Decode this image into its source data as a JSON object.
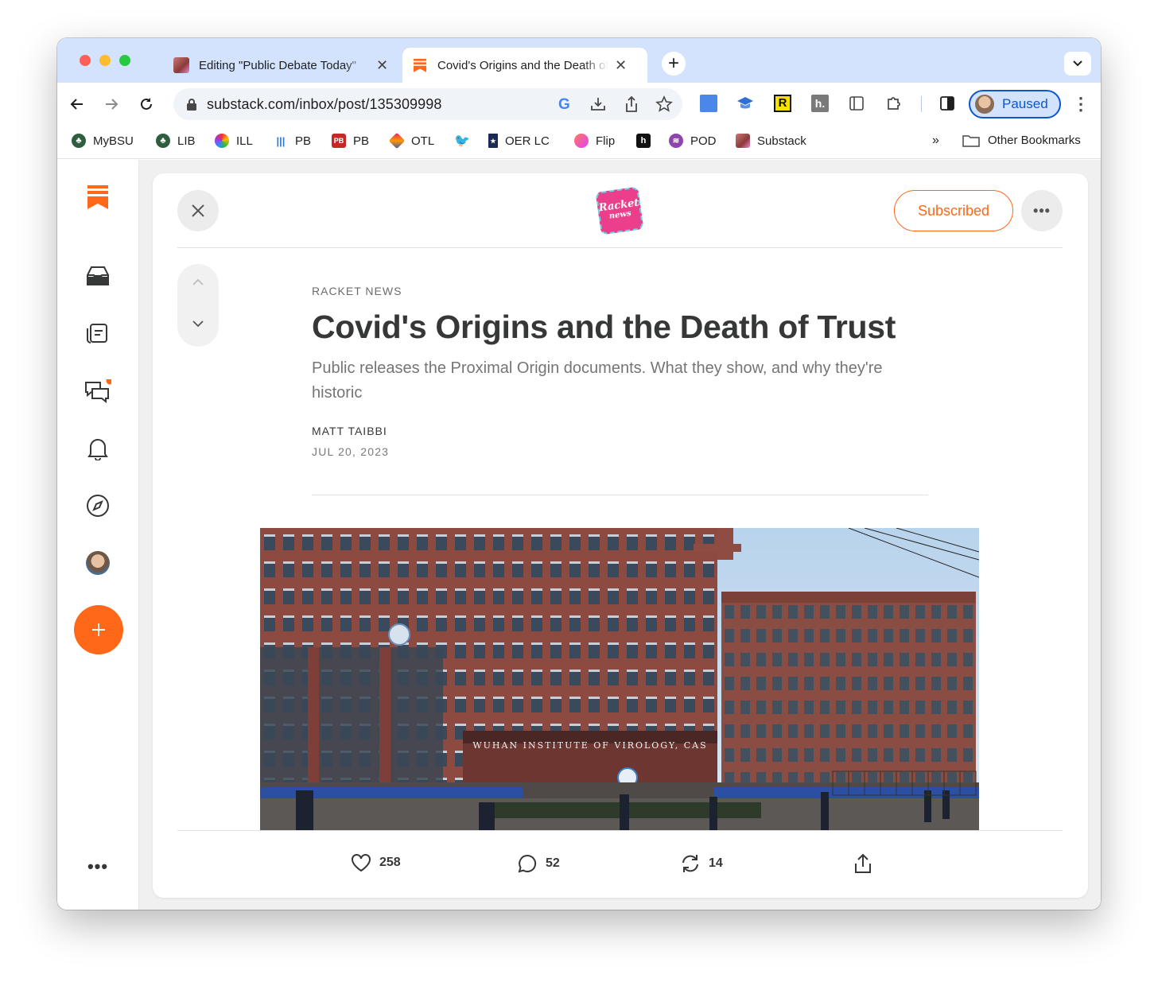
{
  "tabs": [
    {
      "title": "Editing \"Public Debate Today\"",
      "active": false
    },
    {
      "title": "Covid's Origins and the Death of Trust",
      "active": true
    }
  ],
  "address": {
    "url": "substack.com/inbox/post/135309998"
  },
  "profile": {
    "label": "Paused"
  },
  "bookmarks": [
    {
      "label": "MyBSU",
      "icon": "tree-icon"
    },
    {
      "label": "LIB",
      "icon": "tree-icon"
    },
    {
      "label": "ILL",
      "icon": "rainbow-icon"
    },
    {
      "label": "PB",
      "icon": "bars-icon"
    },
    {
      "label": "PB",
      "icon": "pb-icon"
    },
    {
      "label": "OTL",
      "icon": "diamond-icon"
    },
    {
      "label": "",
      "icon": "twitter-icon"
    },
    {
      "label": "OER LC",
      "icon": "bookmark-icon"
    },
    {
      "label": "Flip",
      "icon": "flip-icon"
    },
    {
      "label": "",
      "icon": "h-icon"
    },
    {
      "label": "POD",
      "icon": "spotify-icon"
    },
    {
      "label": "Substack",
      "icon": "substack-icon"
    }
  ],
  "bookmarks_overflow": "»",
  "other_bookmarks": "Other Bookmarks",
  "post": {
    "publication": "RACKET NEWS",
    "title": "Covid's Origins and the Death of Trust",
    "subtitle": "Public releases the Proximal Origin documents. What they show, and why they're historic",
    "author": "MATT TAIBBI",
    "date": "JUL 20, 2023",
    "subscribe_label": "Subscribed",
    "logo_text_1": "Racket",
    "logo_text_2": "news",
    "image_sign": "WUHAN INSTITUTE OF VIROLOGY, CAS"
  },
  "actions": {
    "likes": "258",
    "comments": "52",
    "restacks": "14"
  },
  "colors": {
    "accent": "#ff6719",
    "tab_strip": "#d3e3fd",
    "profile_blue": "#0b57d0"
  }
}
